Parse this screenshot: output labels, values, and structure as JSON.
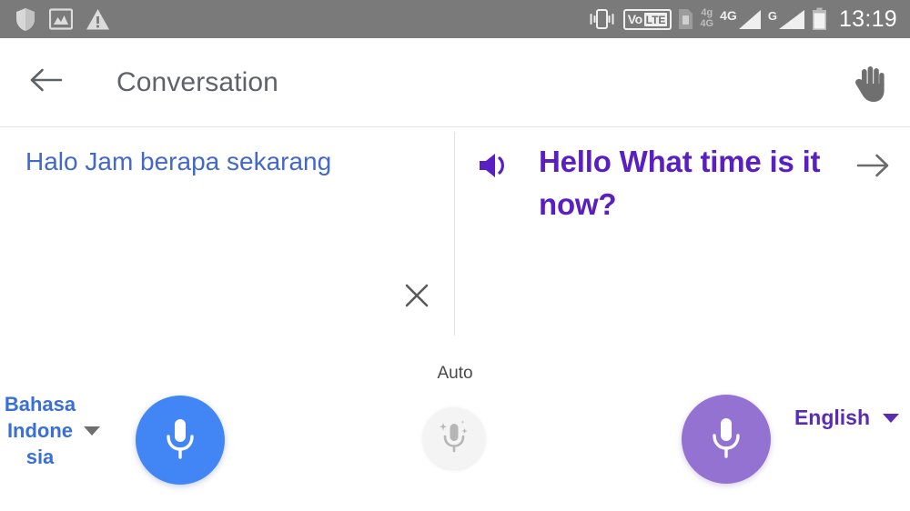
{
  "status_bar": {
    "background_color": "#7a7a7a",
    "time": "13:19",
    "left_icons": [
      {
        "name": "shield-icon",
        "label": "Security shield"
      },
      {
        "name": "photo-icon",
        "label": "Screenshot saved"
      },
      {
        "name": "warning-icon",
        "label": "Warning"
      }
    ],
    "right_icons": [
      {
        "name": "vibrate-icon",
        "label": "Vibrate mode"
      },
      {
        "name": "volte-icon",
        "label": "VoLTE",
        "text_vo": "Vo",
        "text_lte": "LTE"
      },
      {
        "name": "sim-card-icon",
        "label": "SIM 1"
      },
      {
        "name": "network-4g-icon",
        "label": "4G",
        "text_top": "4g",
        "text_bottom": "4G"
      },
      {
        "name": "signal-4g-icon",
        "label": "4G signal",
        "text": "4G"
      },
      {
        "name": "signal-g-icon",
        "label": "G signal",
        "text": "G"
      },
      {
        "name": "battery-icon",
        "label": "Battery"
      }
    ]
  },
  "app_bar": {
    "title": "Conversation",
    "back_icon": "arrow-back-icon",
    "hand_cursor_icon": "hand-cursor-icon"
  },
  "conversation": {
    "source": {
      "text": "Halo Jam berapa sekarang",
      "text_color": "#4368cc",
      "clear_icon": "close-icon"
    },
    "target": {
      "text": "Hello What time is it now?",
      "text_color": "#5a1fc0",
      "speaker_icon": "volume-up-icon",
      "forward_icon": "arrow-forward-icon"
    }
  },
  "bottom_bar": {
    "auto_label": "Auto",
    "auto_mic_icon": "auto-detect-mic-icon",
    "left_language": {
      "label": "Bahasa Indone sia",
      "color": "#3a6fd8",
      "dropdown_icon": "chevron-down-icon",
      "mic_icon": "mic-icon",
      "mic_color": "#4285f4"
    },
    "right_language": {
      "label": "English",
      "color": "#5a2cb5",
      "dropdown_icon": "chevron-down-icon",
      "mic_icon": "mic-icon",
      "mic_color": "#9372d2"
    }
  }
}
